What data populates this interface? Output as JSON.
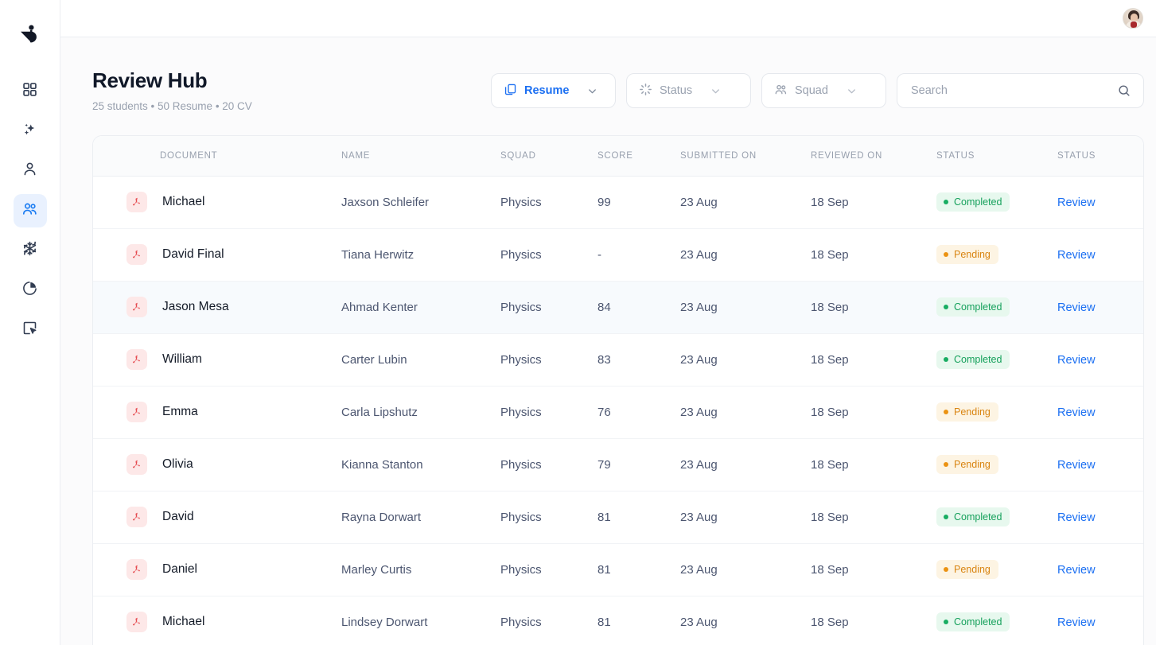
{
  "sidebar": {
    "logo_name": "bird-logo",
    "items": [
      {
        "name": "dashboard",
        "icon": "grid-icon",
        "active": false
      },
      {
        "name": "ai-assist",
        "icon": "sparkles-icon",
        "active": false
      },
      {
        "name": "profile",
        "icon": "user-icon",
        "active": false
      },
      {
        "name": "students",
        "icon": "users-icon",
        "active": true
      },
      {
        "name": "modules",
        "icon": "snowflake-icon",
        "active": false
      },
      {
        "name": "analytics",
        "icon": "pie-chart-icon",
        "active": false
      },
      {
        "name": "review",
        "icon": "cursor-box-icon",
        "active": false
      }
    ]
  },
  "topbar": {
    "avatar_label": "User avatar"
  },
  "header": {
    "title": "Review Hub",
    "subtitle": "25 students • 50 Resume • 20 CV"
  },
  "filters": {
    "resume": {
      "label": "Resume",
      "icon": "copy-document-icon",
      "active": true
    },
    "status": {
      "label": "Status",
      "icon": "spinner-icon",
      "active": false
    },
    "squad": {
      "label": "Squad",
      "icon": "users-icon",
      "active": false
    }
  },
  "search": {
    "placeholder": "Search",
    "value": "",
    "icon": "search-icon"
  },
  "table": {
    "columns": [
      "DOCUMENT",
      "NAME",
      "SQUAD",
      "SCORE",
      "SUBMITTED ON",
      "REVIEWED ON",
      "STATUS",
      "STATUS"
    ],
    "rows": [
      {
        "document": "Michael",
        "name": "Jaxson Schleifer",
        "squad": "Physics",
        "score": "99",
        "submitted": "23 Aug",
        "reviewed": "18 Sep",
        "status": "Completed",
        "status_kind": "completed",
        "action": "Review",
        "highlight": false
      },
      {
        "document": "David Final",
        "name": "Tiana Herwitz",
        "squad": "Physics",
        "score": "-",
        "submitted": "23 Aug",
        "reviewed": "18 Sep",
        "status": "Pending",
        "status_kind": "pending",
        "action": "Review",
        "highlight": false
      },
      {
        "document": "Jason Mesa",
        "name": "Ahmad Kenter",
        "squad": "Physics",
        "score": "84",
        "submitted": "23 Aug",
        "reviewed": "18 Sep",
        "status": "Completed",
        "status_kind": "completed",
        "action": "Review",
        "highlight": true
      },
      {
        "document": "William",
        "name": "Carter Lubin",
        "squad": "Physics",
        "score": "83",
        "submitted": "23 Aug",
        "reviewed": "18 Sep",
        "status": "Completed",
        "status_kind": "completed",
        "action": "Review",
        "highlight": false
      },
      {
        "document": "Emma",
        "name": "Carla Lipshutz",
        "squad": "Physics",
        "score": "76",
        "submitted": "23 Aug",
        "reviewed": "18 Sep",
        "status": "Pending",
        "status_kind": "pending",
        "action": "Review",
        "highlight": false
      },
      {
        "document": "Olivia",
        "name": "Kianna Stanton",
        "squad": "Physics",
        "score": "79",
        "submitted": "23 Aug",
        "reviewed": "18 Sep",
        "status": "Pending",
        "status_kind": "pending",
        "action": "Review",
        "highlight": false
      },
      {
        "document": "David",
        "name": "Rayna Dorwart",
        "squad": "Physics",
        "score": "81",
        "submitted": "23 Aug",
        "reviewed": "18 Sep",
        "status": "Completed",
        "status_kind": "completed",
        "action": "Review",
        "highlight": false
      },
      {
        "document": "Daniel",
        "name": "Marley Curtis",
        "squad": "Physics",
        "score": "81",
        "submitted": "23 Aug",
        "reviewed": "18 Sep",
        "status": "Pending",
        "status_kind": "pending",
        "action": "Review",
        "highlight": false
      },
      {
        "document": "Michael",
        "name": "Lindsey Dorwart",
        "squad": "Physics",
        "score": "81",
        "submitted": "23 Aug",
        "reviewed": "18 Sep",
        "status": "Completed",
        "status_kind": "completed",
        "action": "Review",
        "highlight": false
      }
    ]
  },
  "colors": {
    "accent_blue": "#1b6ff2",
    "active_nav_bg": "#e9f1fe",
    "completed_bg": "#e7f8ee",
    "completed_fg": "#15a05b",
    "pending_bg": "#fdf4e3",
    "pending_fg": "#d98512",
    "pdf_bg": "#fde8e8",
    "pdf_fg": "#e5484d"
  }
}
